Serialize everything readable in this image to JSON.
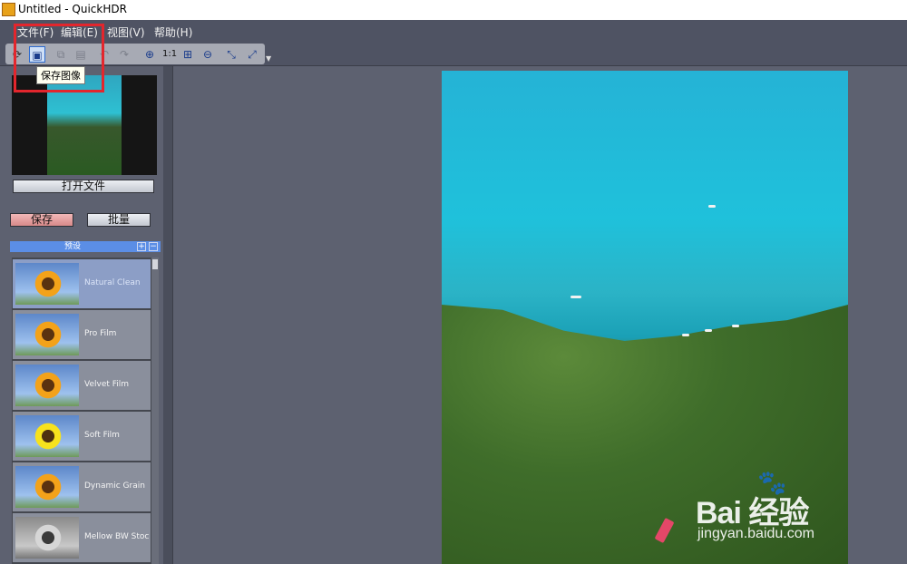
{
  "window": {
    "title": "Untitled - QuickHDR"
  },
  "menu": [
    {
      "label": "文件(F)"
    },
    {
      "label": "编辑(E)"
    },
    {
      "label": "视图(V)"
    },
    {
      "label": "帮助(H)"
    }
  ],
  "toolbar": {
    "zoom_1to1": "1:1",
    "tooltip": "保存图像",
    "icons": [
      "open-icon",
      "save-icon",
      "copy-icon",
      "paste-icon",
      "undo-icon",
      "redo-icon",
      "zoom-in-icon",
      "fit-icon",
      "zoom-out-icon",
      "rotate-icon",
      "flip-icon"
    ]
  },
  "left_panel": {
    "open_file_label": "打开文件",
    "save_label": "保存",
    "batch_label": "批量",
    "presets_title": "预设",
    "presets": [
      {
        "label": "Natural Clean"
      },
      {
        "label": "Pro Film"
      },
      {
        "label": "Velvet Film"
      },
      {
        "label": "Soft Film"
      },
      {
        "label": "Dynamic Grain"
      },
      {
        "label": "Mellow BW Stoc"
      }
    ]
  },
  "watermark": {
    "main": "Bai 经验",
    "sub": "jingyan.baidu.com"
  },
  "colors": {
    "highlight": "#e3262d",
    "background": "#5d6170",
    "preset_header": "#5b8ee6",
    "save_button": "#e8a6a6"
  }
}
